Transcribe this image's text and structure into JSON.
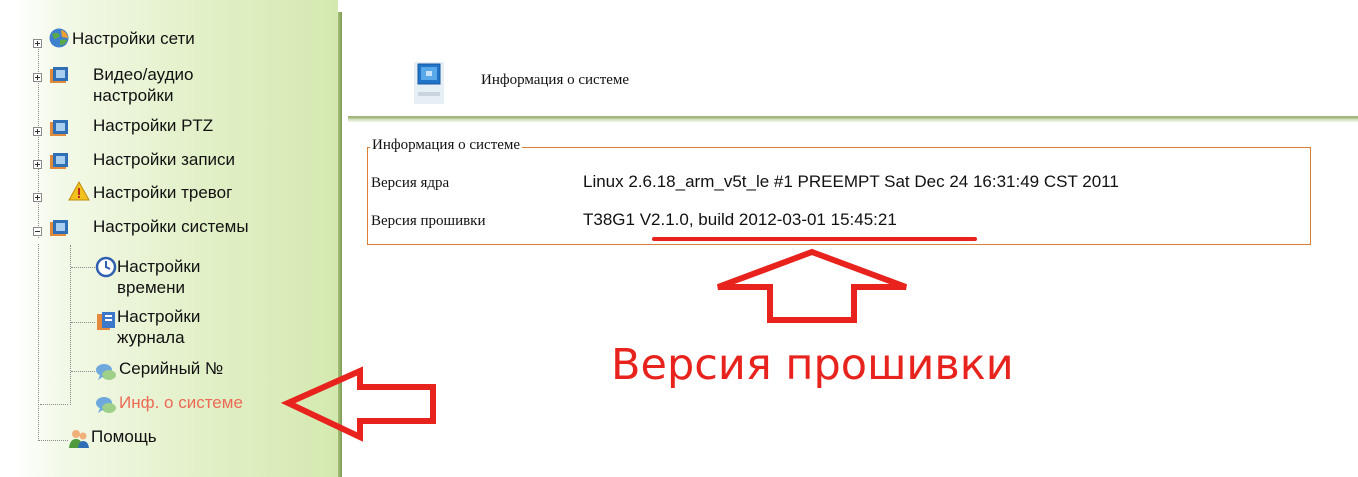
{
  "sidebar": {
    "items": [
      {
        "label": "Настройки сети"
      },
      {
        "label": "Видео/аудио",
        "label2": "настройки"
      },
      {
        "label": "Настройки PTZ"
      },
      {
        "label": "Настройки записи"
      },
      {
        "label": "Настройки тревог"
      },
      {
        "label": "Настройки системы"
      },
      {
        "label": "Настройки",
        "label2": "времени"
      },
      {
        "label": "Настройки",
        "label2": "журнала"
      },
      {
        "label": "Серийный №"
      },
      {
        "label": "Инф. о системе"
      },
      {
        "label": "Помощь"
      }
    ]
  },
  "header": {
    "title": "Информация о системе"
  },
  "info": {
    "legend": "Информация о системе",
    "rows": [
      {
        "label": "Версия ядра",
        "value": "Linux 2.6.18_arm_v5t_le #1 PREEMPT Sat Dec 24 16:31:49 CST 2011"
      },
      {
        "label": "Версия прошивки",
        "value": "T38G1 V2.1.0, build 2012-03-01 15:45:21"
      }
    ]
  },
  "annotation": {
    "text": "Версия прошивки"
  },
  "colors": {
    "accent_red": "#e8231d",
    "active_item": "#ec6a55",
    "fieldset_border": "#d97f3a",
    "sidebar_green": "#d4e9b0"
  },
  "icons": {
    "network": "globe-icon",
    "video": "camera-icon",
    "ptz": "camera-icon",
    "record": "camera-icon",
    "alarm": "warning-icon",
    "system": "camera-icon",
    "time": "clock-icon",
    "log": "journal-icon",
    "serial": "chat-icon",
    "sysinfo": "chat-icon",
    "help": "people-icon",
    "header": "monitor-icon"
  }
}
